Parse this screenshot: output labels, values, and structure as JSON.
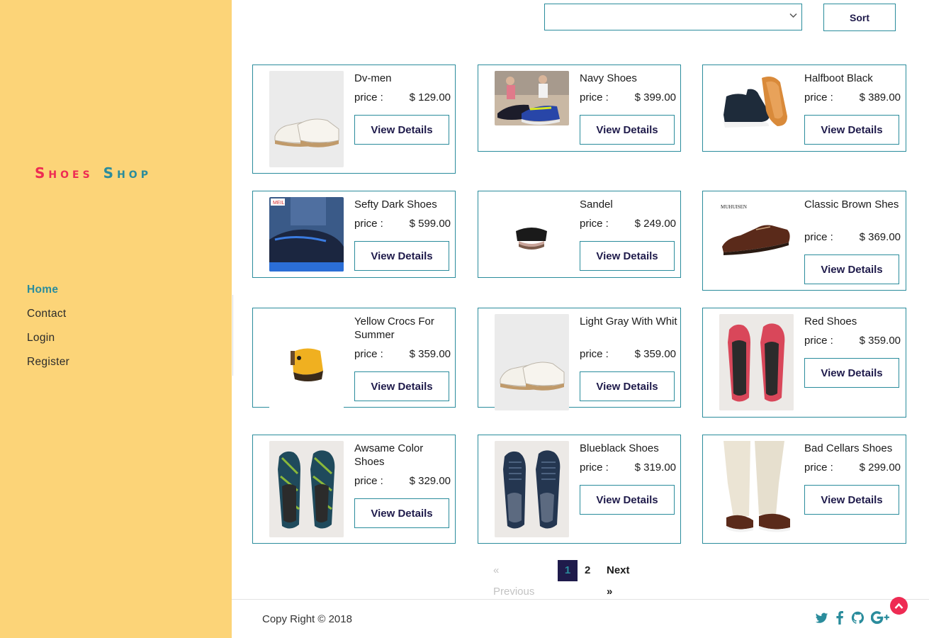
{
  "brand": {
    "word1": "Shoes",
    "word2": "Shop"
  },
  "nav": {
    "items": [
      "Home",
      "Contact",
      "Login",
      "Register"
    ],
    "active": "Home"
  },
  "toolbar": {
    "select_value": "",
    "sort_label": "Sort"
  },
  "price_label": "price :",
  "view_label": "View Details",
  "products": [
    {
      "name": "Dv-men",
      "price": "$ 129.00",
      "icon": "white-sneaker"
    },
    {
      "name": "Navy Shoes",
      "price": "$ 399.00",
      "icon": "navy-running-shoes"
    },
    {
      "name": "Halfboot Black",
      "price": "$ 389.00",
      "icon": "black-halfboot"
    },
    {
      "name": "Sefty Dark Shoes",
      "price": "$ 599.00",
      "icon": "dark-safety-shoe",
      "image_text": "MEIL"
    },
    {
      "name": "Sandel",
      "price": "$ 249.00",
      "icon": "sandal"
    },
    {
      "name": "Classic Brown Shes",
      "price": "$ 369.00",
      "icon": "brown-shoe",
      "image_text": "MUHUISEN"
    },
    {
      "name": "Yellow Crocs For Summer",
      "price": "$ 359.00",
      "icon": "yellow-croc"
    },
    {
      "name": "Light Gray With Whit",
      "price": "$ 359.00",
      "icon": "white-sneaker"
    },
    {
      "name": "Red Shoes",
      "price": "$ 359.00",
      "icon": "red-slipons"
    },
    {
      "name": "Awsame Color Shoes",
      "price": "$ 329.00",
      "icon": "patterned-slipons"
    },
    {
      "name": "Blueblack Shoes",
      "price": "$ 319.00",
      "icon": "navy-sneakers"
    },
    {
      "name": "Bad Cellars Shoes",
      "price": "$ 299.00",
      "icon": "boat-shoes"
    }
  ],
  "pagination": {
    "prev": "«  Previous",
    "pages": [
      "1",
      "2"
    ],
    "current": "1",
    "next": "Next  »"
  },
  "footer": {
    "copyright": "Copy Right © 2018",
    "social": [
      "twitter-icon",
      "facebook-icon",
      "github-icon",
      "google-plus-icon"
    ]
  },
  "colors": {
    "sidebar": "#fcd478",
    "accent": "#2a8c9c",
    "brand_red": "#ee2b53",
    "dark": "#1f1b4b"
  }
}
